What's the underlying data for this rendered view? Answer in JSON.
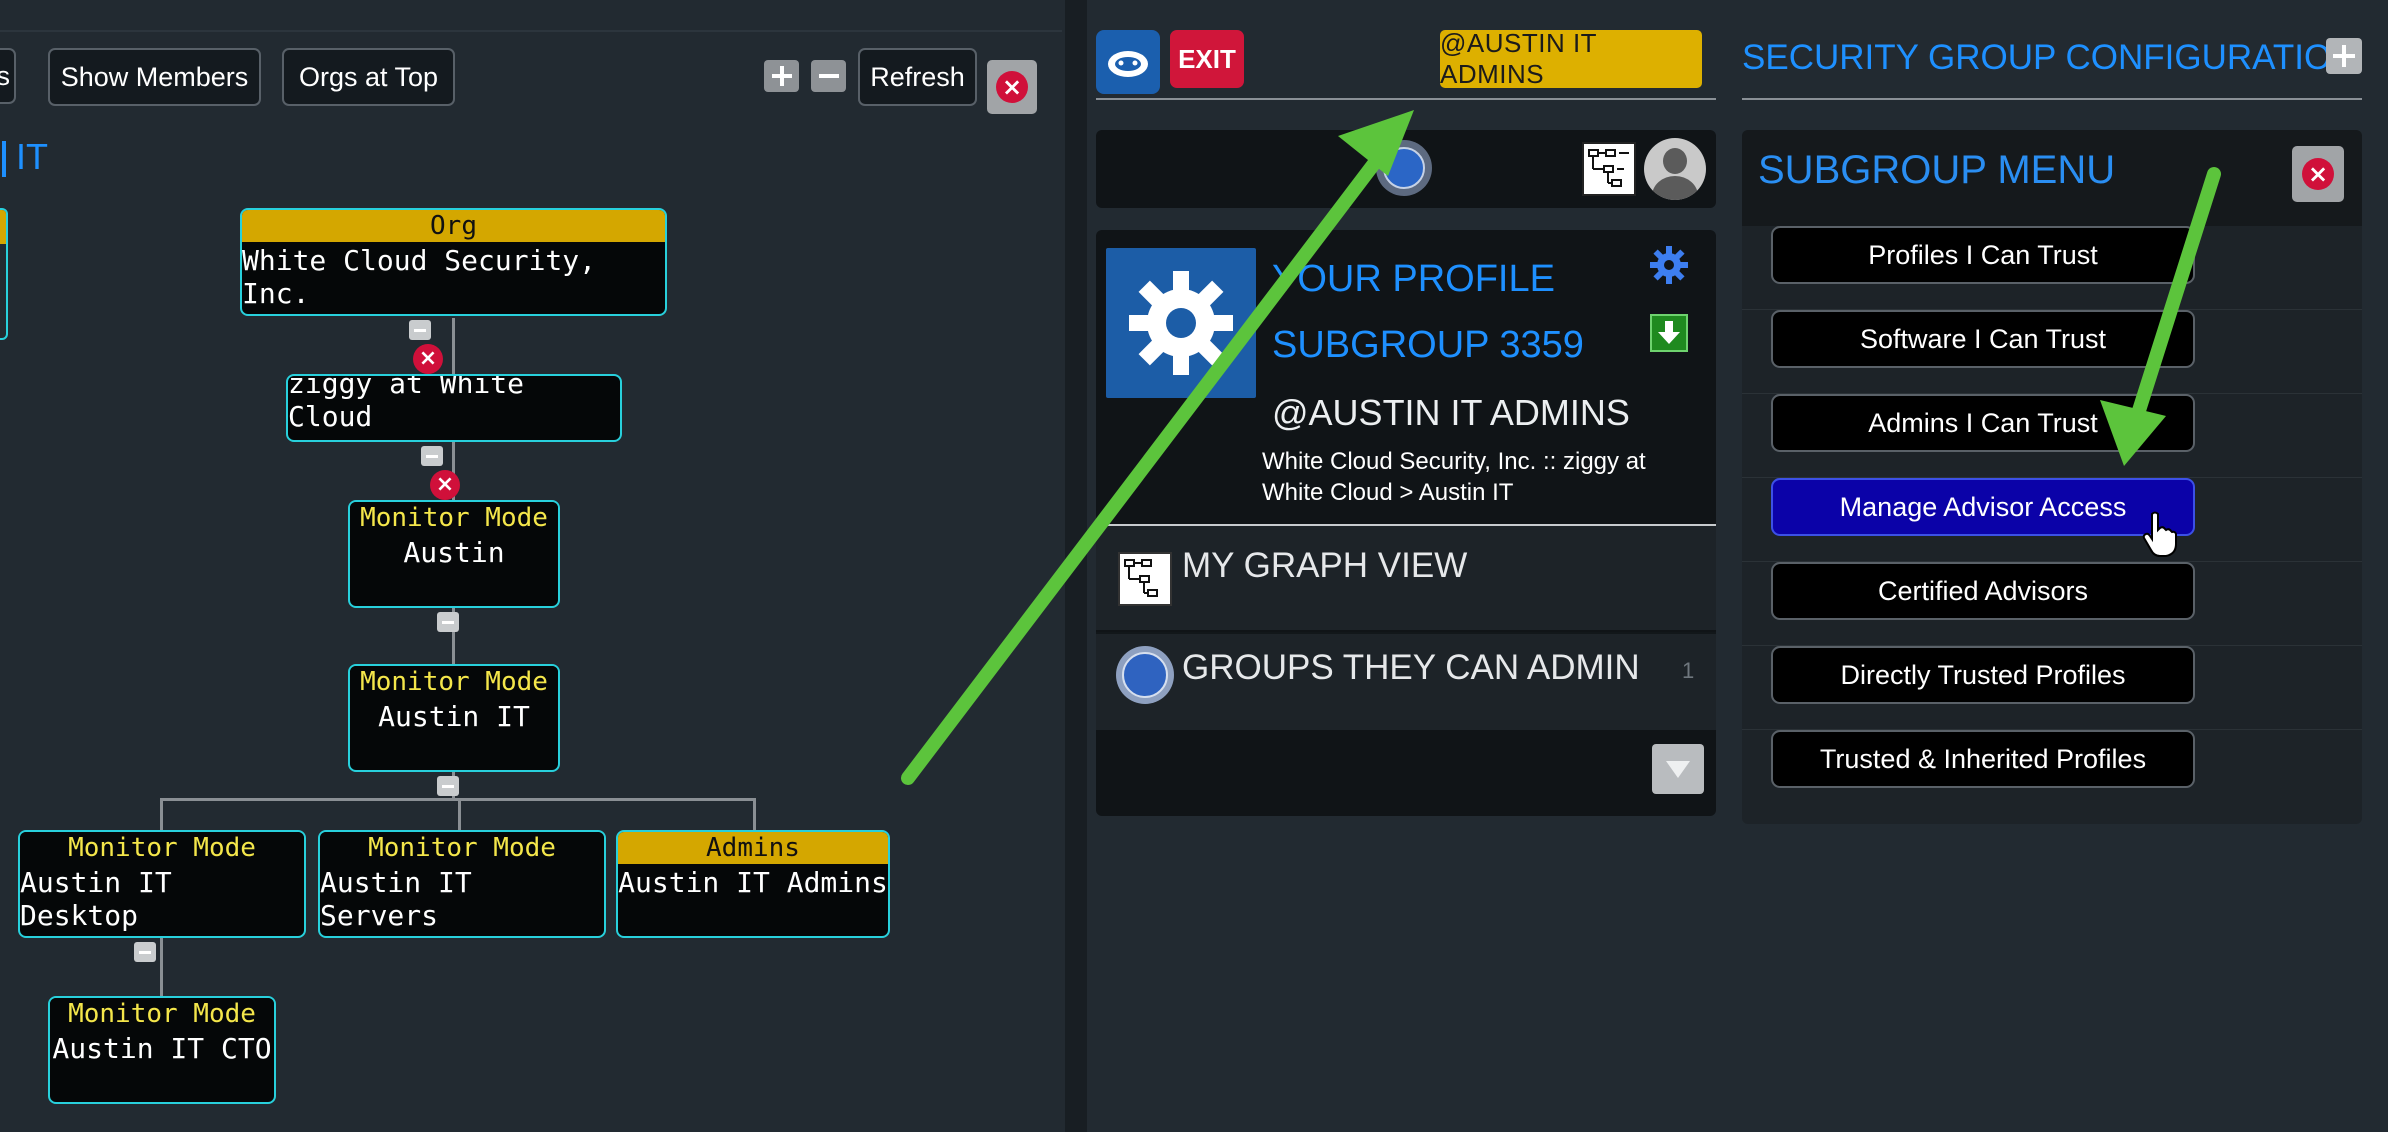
{
  "toolbar": {
    "partial_label": "es",
    "show_members": "Show Members",
    "orgs_at_top": "Orgs at Top",
    "refresh": "Refresh"
  },
  "graph": {
    "title_fragment": "IT",
    "org_node": {
      "header": "Org",
      "name": "White Cloud Security, Inc."
    },
    "user_node": {
      "name": "ziggy at White Cloud"
    },
    "austin": {
      "header": "Monitor Mode",
      "name": "Austin"
    },
    "austin_it": {
      "header": "Monitor Mode",
      "name": "Austin IT"
    },
    "desktop": {
      "header": "Monitor Mode",
      "name": "Austin IT Desktop"
    },
    "servers": {
      "header": "Monitor Mode",
      "name": "Austin IT Servers"
    },
    "admins": {
      "header": "Admins",
      "name": "Austin IT Admins"
    },
    "cto": {
      "header": "Monitor Mode",
      "name": "Austin IT CTO"
    }
  },
  "profile_panel": {
    "exit": "EXIT",
    "admin_tag": "@AUSTIN IT ADMINS",
    "your_profile": "YOUR PROFILE",
    "subgroup": "SUBGROUP 3359",
    "admin_name": "@AUSTIN IT ADMINS",
    "path_line1": "White Cloud Security, Inc. :: ziggy at",
    "path_line2": "White Cloud > Austin IT",
    "menu": {
      "graph_view": "MY GRAPH VIEW",
      "groups_admin": "GROUPS THEY CAN ADMIN",
      "groups_admin_count": "1"
    }
  },
  "config_panel": {
    "title": "SECURITY GROUP CONFIGURATION",
    "subgroup_menu": "SUBGROUP MENU",
    "items": [
      "Profiles I Can Trust",
      "Software I Can Trust",
      "Admins I Can Trust",
      "Manage Advisor Access",
      "Certified Advisors",
      "Directly Trusted Profiles",
      "Trusted & Inherited Profiles"
    ],
    "active_index": 3
  },
  "colors": {
    "background": "#222a31",
    "node_border": "#28d0dc",
    "mode_text": "#f4e64a",
    "band": "#d4a700",
    "accent_blue": "#1e90ff",
    "active_button": "#0b02a8",
    "close_red": "#d0103a",
    "annotation_arrow": "#5cc43c"
  },
  "icons": {
    "cloud": "cloud-icon",
    "gear": "gear-icon",
    "download": "download-arrow-icon",
    "graph": "graph-view-icon",
    "groups": "groups-icon",
    "avatar": "avatar-icon",
    "cursor": "hand-cursor-icon"
  }
}
